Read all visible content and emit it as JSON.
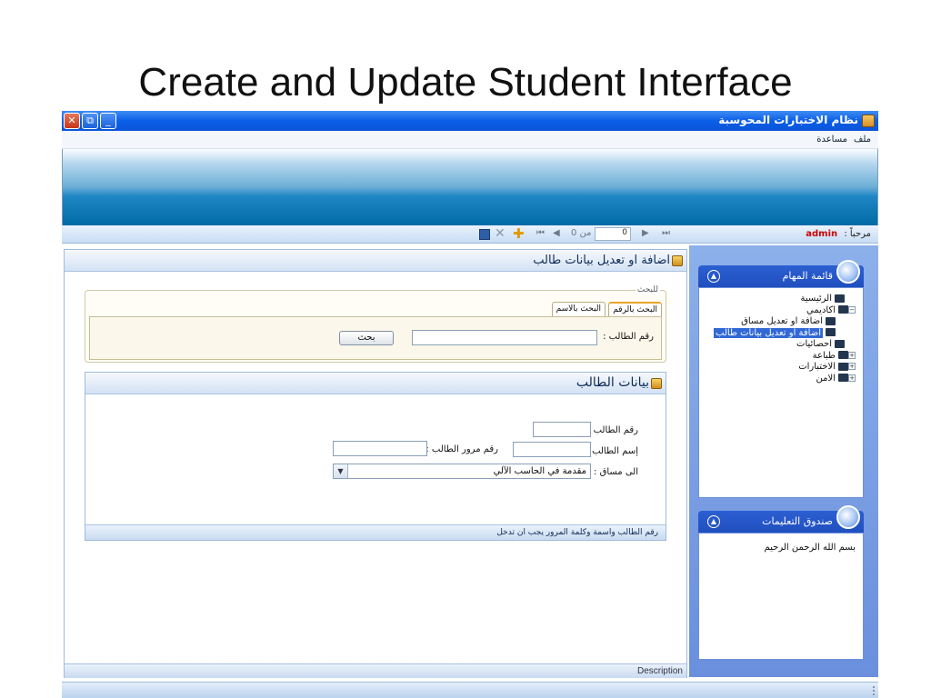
{
  "slide": {
    "title": "Create and Update Student Interface"
  },
  "window": {
    "title": "نظام الاختبارات المحوسبة",
    "controls": {
      "close": "✕",
      "maximize": "⧉",
      "minimize": "_"
    }
  },
  "menu": {
    "items": [
      "ملف",
      "مساعدة"
    ]
  },
  "toolbar": {
    "welcome_label": "مرحباً :",
    "user": "admin",
    "record_position": "0",
    "record_of": "من 0",
    "nav_first": "⏮",
    "nav_prev": "◀",
    "nav_next": "▶",
    "nav_last": "⏭",
    "icons": [
      "save-icon",
      "delete-icon",
      "add-icon"
    ]
  },
  "page": {
    "title": "اضافة او تعديل بيانات طالب"
  },
  "search": {
    "legend": "للبحث",
    "tabs": [
      "البحث بالرقم",
      "البحث بالاسم"
    ],
    "active_tab": "البحث بالرقم",
    "number_label": "رقم الطالب :",
    "number_value": "",
    "search_button": "بحث"
  },
  "student": {
    "title": "بيانات الطالب",
    "id_label": "رقم الطالب :",
    "id_value": "",
    "name_label": "إسم الطالب :",
    "name_value": "",
    "password_label": "رقم مرور الطالب :",
    "password_value": "",
    "course_label": "الى مساق :",
    "course_value": "مقدمة في الحاسب الآلي",
    "footer_note": "رقم الطالب واسمة وكلمة المرور يجب ان تدخل"
  },
  "description_label": "Description",
  "tasks": {
    "title": "قائمة المهام",
    "tree": [
      {
        "label": "الرئيسية",
        "level": 0,
        "toggle": ""
      },
      {
        "label": "اكاديمي",
        "level": 0,
        "toggle": "−"
      },
      {
        "label": "اضافة او تعديل  مساق",
        "level": 1,
        "toggle": ""
      },
      {
        "label": "اضافة او تعديل بيانات طالب",
        "level": 1,
        "toggle": "",
        "selected": true
      },
      {
        "label": "احصائيات",
        "level": 0,
        "toggle": ""
      },
      {
        "label": "طباعة",
        "level": 0,
        "toggle": "+"
      },
      {
        "label": "الاختبارات",
        "level": 0,
        "toggle": "+"
      },
      {
        "label": "الامن",
        "level": 0,
        "toggle": "+"
      }
    ]
  },
  "news": {
    "title": "صندوق التعليمات",
    "text": "بسم الله الرحمن الرحيم"
  },
  "colors": {
    "titlebar": "#0b5ee8",
    "sidepanel": "#7a9de2",
    "selected_item": "#3168d5",
    "admin_text": "#cc0000"
  }
}
